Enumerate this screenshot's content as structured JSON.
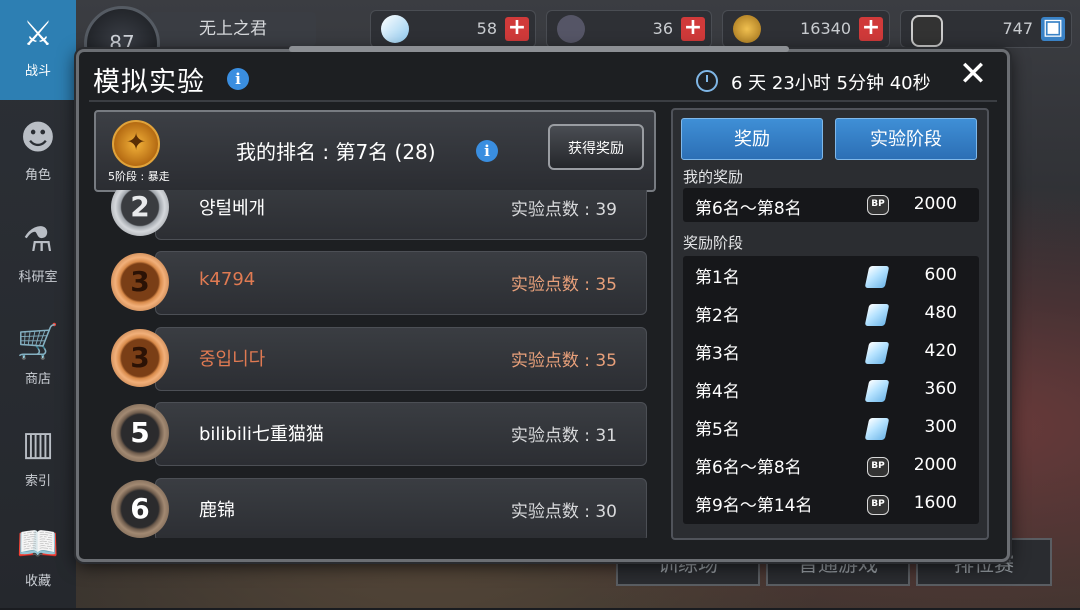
{
  "nav": [
    {
      "label": "战斗",
      "icon": "crossed-swords-icon",
      "active": true
    },
    {
      "label": "角色",
      "icon": "character-icon",
      "active": false
    },
    {
      "label": "科研室",
      "icon": "flask-icon",
      "active": false
    },
    {
      "label": "商店",
      "icon": "cart-icon",
      "active": false
    },
    {
      "label": "索引",
      "icon": "books-icon",
      "active": false
    },
    {
      "label": "收藏",
      "icon": "open-book-icon",
      "active": false
    }
  ],
  "player": {
    "level": "87",
    "name": "无上之君"
  },
  "resources": [
    {
      "icon": "diamond-icon",
      "value": "58"
    },
    {
      "icon": "ticket-icon",
      "value": "36"
    },
    {
      "icon": "coin-icon",
      "value": "16340"
    },
    {
      "icon": "bp-icon",
      "value": "747"
    }
  ],
  "background_buttons": [
    "训练场",
    "普通游戏",
    "排位赛"
  ],
  "dialog": {
    "title": "模拟实验",
    "timer": "6 天 23小时 5分钟 40秒",
    "close": "✕",
    "rank": {
      "stage": "5阶段 : 暴走",
      "text": "我的排名 : 第7名 (28)",
      "claim_button": "获得奖励"
    },
    "leaderboard": [
      {
        "rank": "2",
        "name": "양털베개",
        "score": "实验点数 : 39",
        "tier": "silver"
      },
      {
        "rank": "3",
        "name": "k4794",
        "score": "实验点数 : 35",
        "tier": "bronze"
      },
      {
        "rank": "3",
        "name": "중입니다",
        "score": "实验点数 : 35",
        "tier": "bronze"
      },
      {
        "rank": "5",
        "name": "bilibili七重猫猫",
        "score": "实验点数 : 31",
        "tier": "plain"
      },
      {
        "rank": "6",
        "name": "鹿锦",
        "score": "实验点数 : 30",
        "tier": "plain"
      }
    ],
    "tabs": [
      "奖励",
      "实验阶段"
    ],
    "my_reward_label": "我的奖励",
    "my_reward": {
      "name": "第6名～第8名",
      "icon": "bp",
      "value": "2000"
    },
    "reward_stage_label": "奖励阶段",
    "rewards": [
      {
        "name": "第1名",
        "icon": "diamond",
        "value": "600"
      },
      {
        "name": "第2名",
        "icon": "diamond",
        "value": "480"
      },
      {
        "name": "第3名",
        "icon": "diamond",
        "value": "420"
      },
      {
        "name": "第4名",
        "icon": "diamond",
        "value": "360"
      },
      {
        "name": "第5名",
        "icon": "diamond",
        "value": "300"
      },
      {
        "name": "第6名～第8名",
        "icon": "bp",
        "value": "2000"
      },
      {
        "name": "第9名～第14名",
        "icon": "bp",
        "value": "1600"
      }
    ]
  }
}
